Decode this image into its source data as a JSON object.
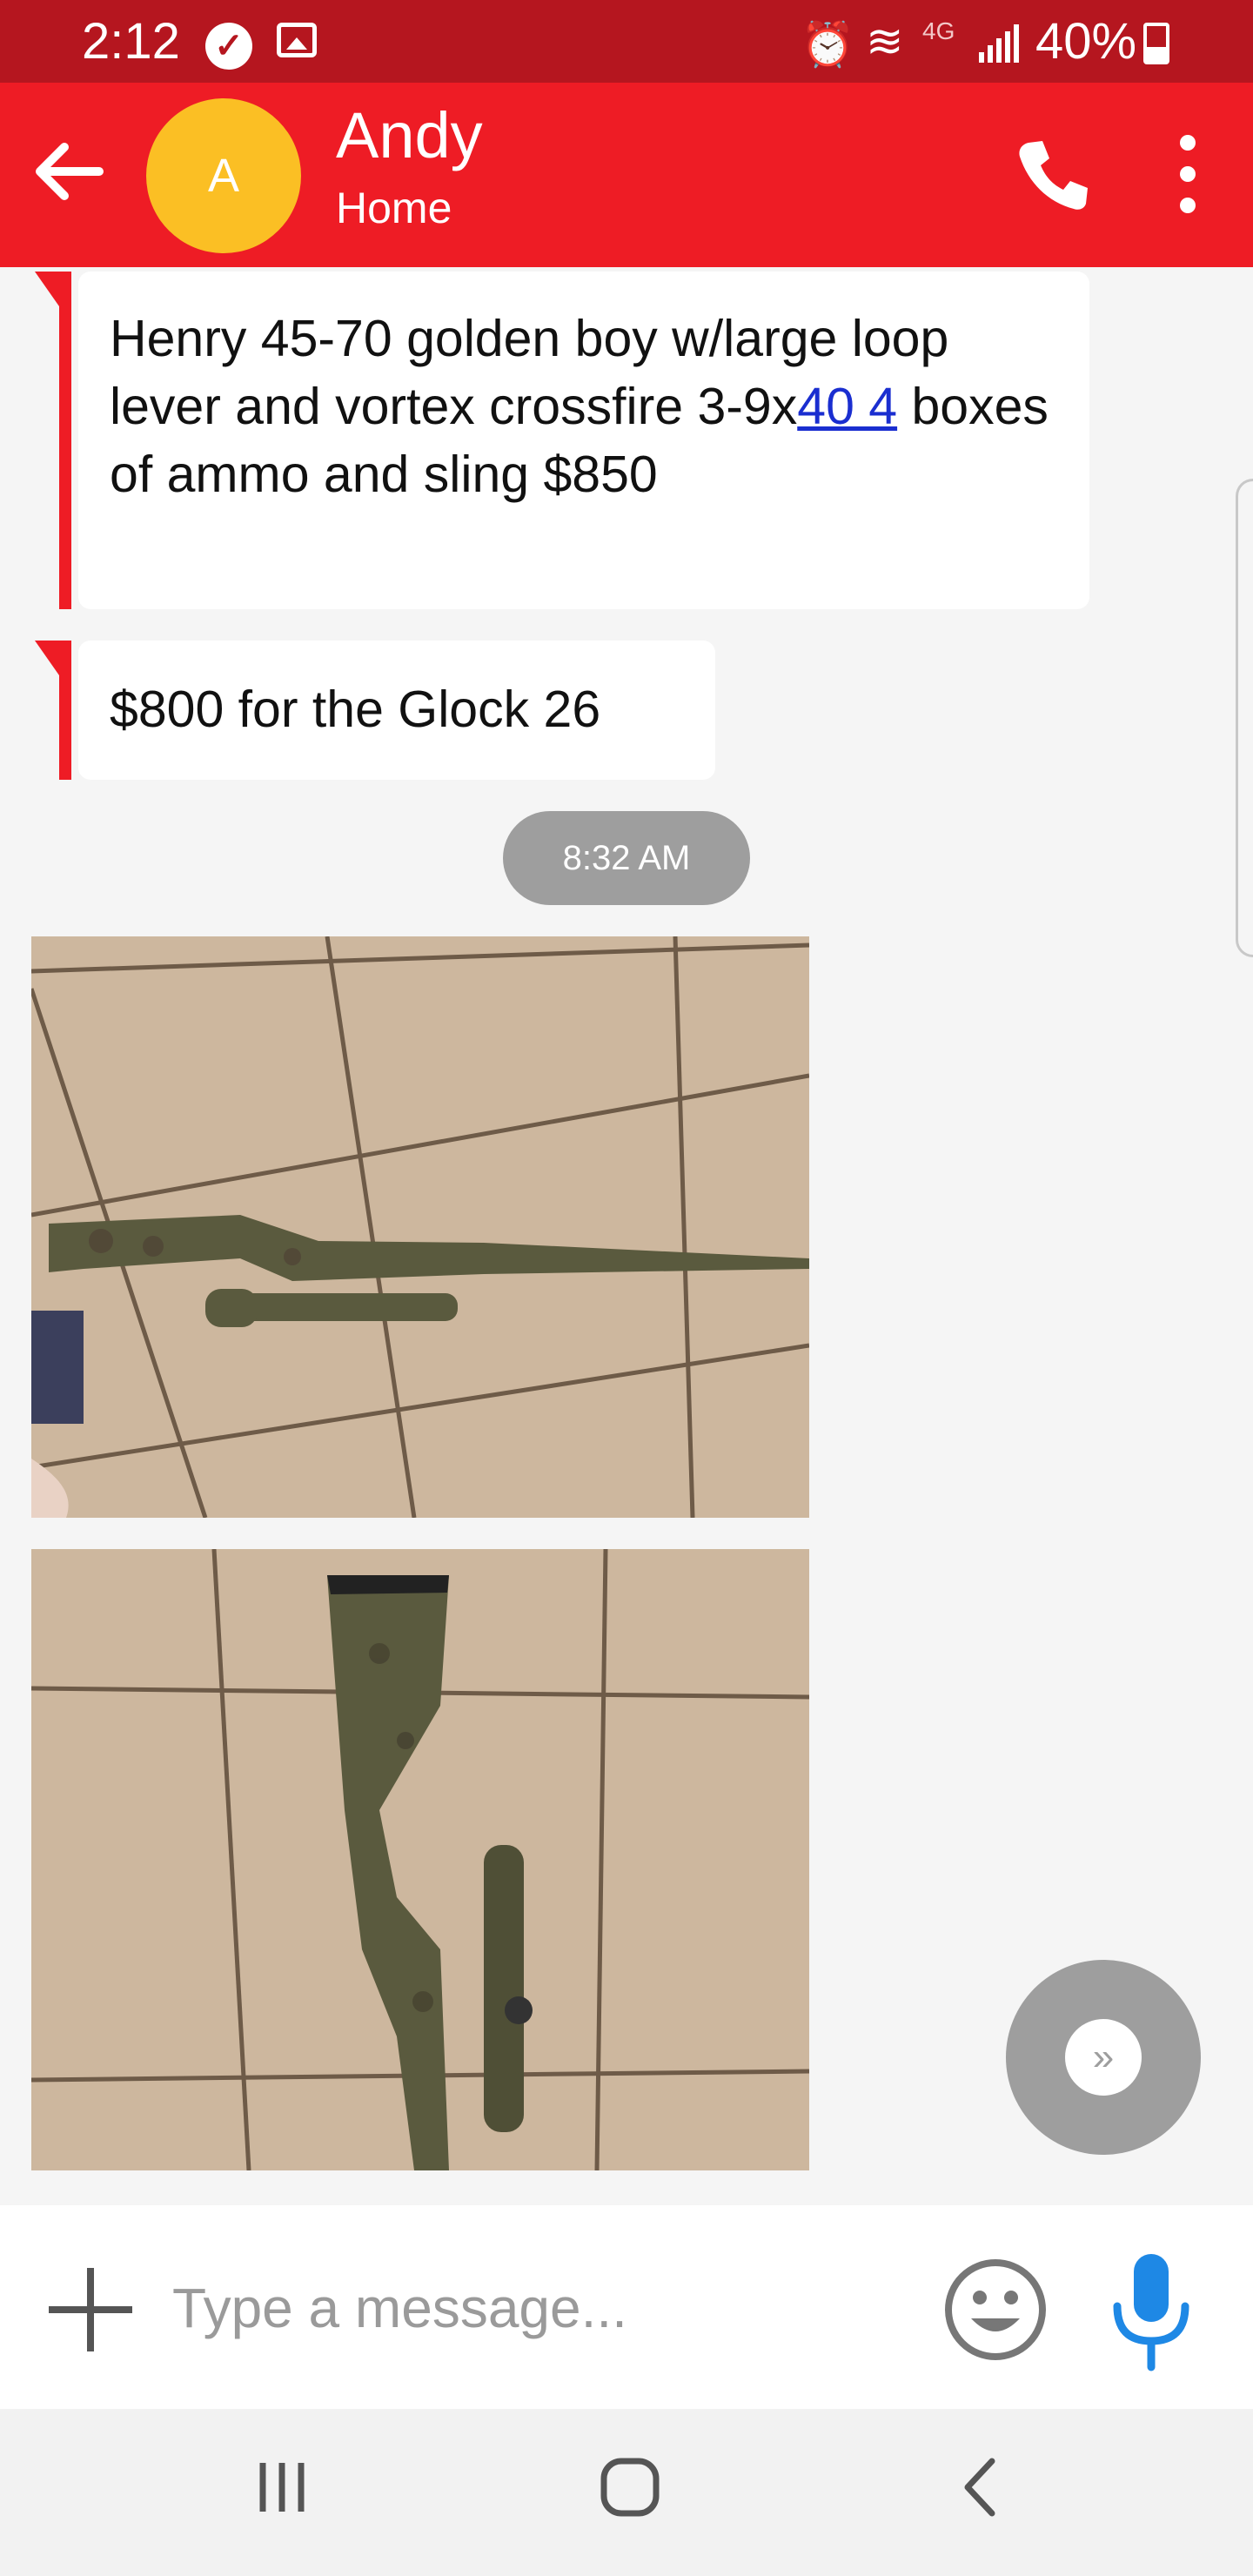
{
  "status_bar": {
    "time": "2:12",
    "network": "4G",
    "battery": "40%"
  },
  "header": {
    "contact_initial": "A",
    "contact_name": "Andy",
    "contact_label": "Home"
  },
  "messages": [
    {
      "text_before_link": "Henry 45-70 golden boy w/large loop lever and vortex crossfire 3-9x",
      "link_text": "40     4",
      "text_after_link": " boxes of ammo and sling $850"
    },
    {
      "text": "$800 for the Glock 26"
    }
  ],
  "timestamp": "8:32 AM",
  "composer": {
    "placeholder": "Type a message..."
  },
  "colors": {
    "accent": "#ee1c25",
    "status_bar": "#b5161f",
    "avatar": "#fbbf24",
    "mic": "#1e88e5"
  }
}
